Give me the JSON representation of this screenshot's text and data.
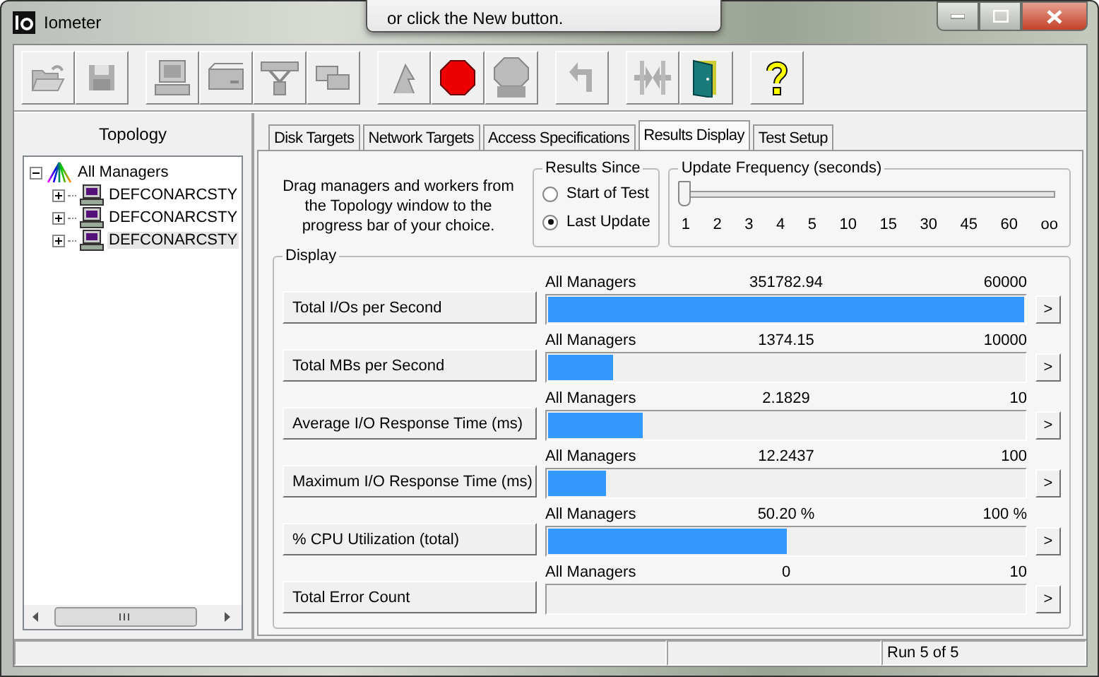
{
  "window": {
    "title": "Iometer"
  },
  "tooltip": {
    "text": "or click the New button."
  },
  "toolbar": [
    {
      "buttons": [
        {
          "kind": "open",
          "disabled": true
        },
        {
          "kind": "save",
          "disabled": true
        }
      ]
    },
    {
      "buttons": [
        {
          "kind": "computer",
          "disabled": true
        },
        {
          "kind": "disk",
          "disabled": true
        },
        {
          "kind": "network",
          "disabled": true
        },
        {
          "kind": "copy",
          "disabled": true
        }
      ]
    },
    {
      "buttons": [
        {
          "kind": "flag",
          "disabled": true
        },
        {
          "kind": "stop",
          "disabled": false
        },
        {
          "kind": "stop-all",
          "disabled": true
        }
      ]
    },
    {
      "buttons": [
        {
          "kind": "reset",
          "disabled": true
        }
      ]
    },
    {
      "buttons": [
        {
          "kind": "disconnect",
          "disabled": true
        },
        {
          "kind": "exit",
          "disabled": false
        }
      ]
    },
    {
      "buttons": [
        {
          "kind": "help",
          "disabled": false
        }
      ]
    }
  ],
  "topology": {
    "title": "Topology",
    "tree": [
      {
        "label": "All Managers",
        "expanded": true,
        "selected": false,
        "children": [
          {
            "label": "DEFCONARCSTY",
            "expanded": false,
            "selected": false
          },
          {
            "label": "DEFCONARCSTY",
            "expanded": false,
            "selected": false
          },
          {
            "label": "DEFCONARCSTY",
            "expanded": false,
            "selected": true
          }
        ]
      }
    ]
  },
  "tabs": [
    {
      "label": "Disk Targets",
      "selected": false
    },
    {
      "label": "Network Targets",
      "selected": false
    },
    {
      "label": "Access Specifications",
      "selected": false
    },
    {
      "label": "Results Display",
      "selected": true
    },
    {
      "label": "Test Setup",
      "selected": false
    }
  ],
  "instructions": "Drag managers and workers from the Topology window to the progress bar of your choice.",
  "results_since": {
    "title": "Results Since",
    "options": [
      {
        "label": "Start of Test",
        "selected": false
      },
      {
        "label": "Last Update",
        "selected": true
      }
    ]
  },
  "update_frequency": {
    "title": "Update Frequency (seconds)",
    "level": 0,
    "ticks": [
      "1",
      "2",
      "3",
      "4",
      "5",
      "10",
      "15",
      "30",
      "45",
      "60",
      "oo"
    ]
  },
  "display": {
    "title": "Display",
    "rows": [
      {
        "label": "Total I/Os per Second",
        "manager": "All Managers",
        "value": "351782.94",
        "max": "60000",
        "level": 1.0,
        "arrow": ">"
      },
      {
        "label": "Total MBs per Second",
        "manager": "All Managers",
        "value": "1374.15",
        "max": "10000",
        "level": 0.137,
        "arrow": ">"
      },
      {
        "label": "Average I/O Response Time (ms)",
        "manager": "All Managers",
        "value": "2.1829",
        "max": "10",
        "level": 0.2,
        "arrow": ">"
      },
      {
        "label": "Maximum I/O Response Time (ms)",
        "manager": "All Managers",
        "value": "12.2437",
        "max": "100",
        "level": 0.122,
        "arrow": ">"
      },
      {
        "label": "% CPU Utilization (total)",
        "manager": "All Managers",
        "value": "50.20 %",
        "max": "100 %",
        "level": 0.502,
        "arrow": ">"
      },
      {
        "label": "Total Error Count",
        "manager": "All Managers",
        "value": "0",
        "max": "10",
        "level": 0,
        "arrow": ">"
      }
    ]
  },
  "status_bar": {
    "text": "Run 5 of 5"
  }
}
